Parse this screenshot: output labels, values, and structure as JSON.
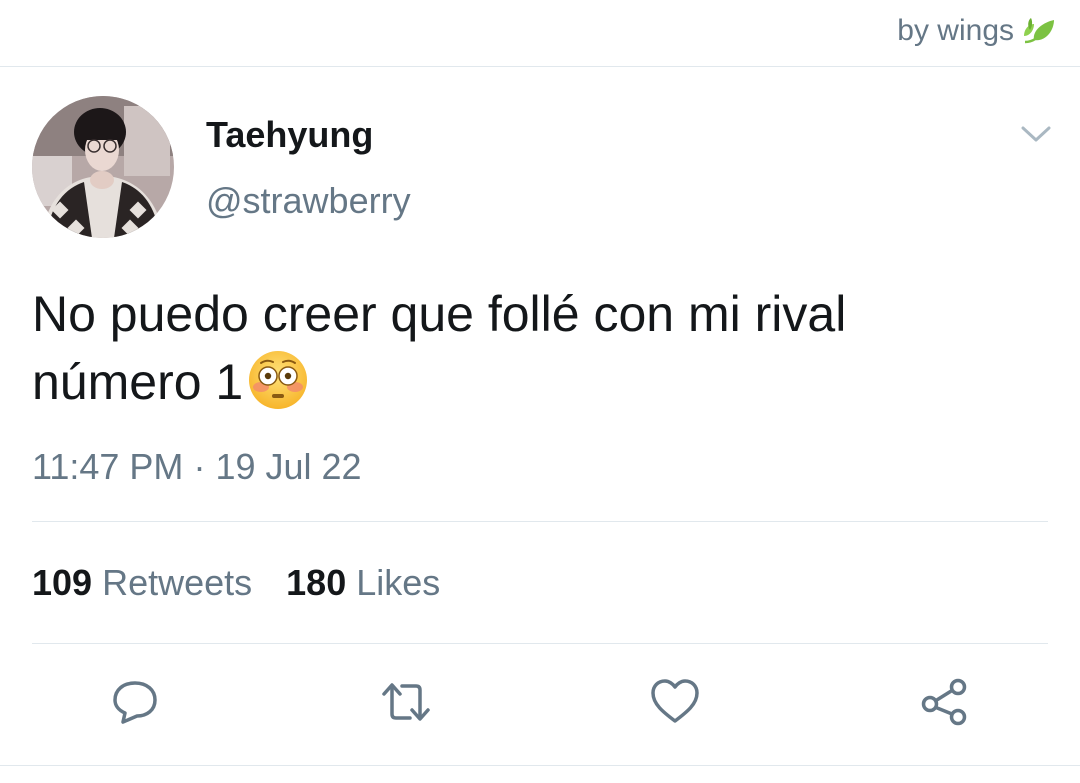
{
  "watermark": {
    "text": "by wings",
    "icon": "leaf-icon"
  },
  "author": {
    "name": "Taehyung",
    "handle": "@strawberry",
    "avatar": "profile-photo"
  },
  "tweet": {
    "line1": "No puedo creer que follé con mi rival",
    "line2": "número 1",
    "emoji": "flushed-face-emoji"
  },
  "meta": {
    "time": "11:47 PM",
    "separator": "·",
    "date": "19 Jul 22"
  },
  "stats": {
    "retweets_count": "109",
    "retweets_label": "Retweets",
    "likes_count": "180",
    "likes_label": "Likes"
  },
  "actions": [
    "reply-icon",
    "retweet-icon",
    "like-icon",
    "share-icon"
  ],
  "colors": {
    "text_primary": "#14171a",
    "text_secondary": "#657786",
    "divider": "#e1e8ed",
    "icon": "#657786",
    "leaf_green": "#7cc242"
  }
}
